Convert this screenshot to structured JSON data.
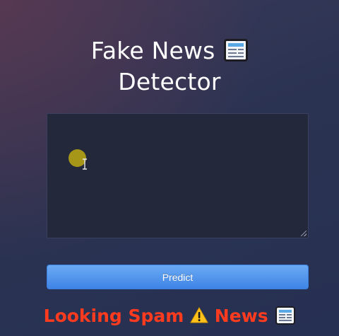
{
  "heading": {
    "line1": "Fake News",
    "line2": "Detector",
    "icon": "newspaper-icon"
  },
  "input": {
    "value": "",
    "placeholder": ""
  },
  "predict_button": {
    "label": "Predict",
    "color": "#4a8fea"
  },
  "result": {
    "text_before": "Looking Spam",
    "warning_icon": "warning-icon",
    "text_after": "News",
    "news_icon": "newspaper-icon",
    "color": "#ff3b1f"
  }
}
